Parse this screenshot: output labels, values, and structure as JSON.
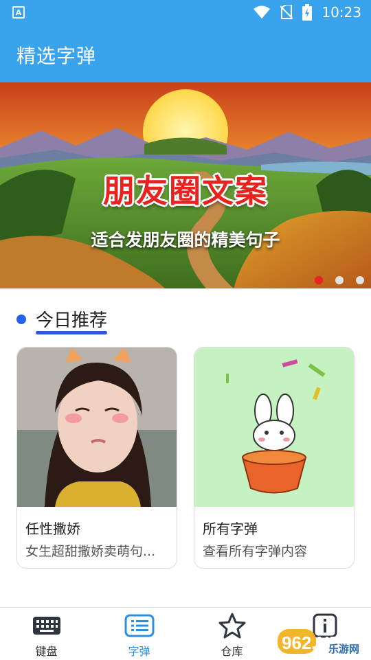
{
  "status_bar": {
    "time": "10:23"
  },
  "app_bar": {
    "title": "精选字弹"
  },
  "banner": {
    "headline": "朋友圈文案",
    "subline": "适合发朋友圈的精美句子",
    "slides": 3,
    "active_slide": 1
  },
  "section": {
    "title": "今日推荐"
  },
  "cards": [
    {
      "name": "任性撒娇",
      "desc": "女生超甜撒娇卖萌句..."
    },
    {
      "name": "所有字弹",
      "desc": "查看所有字弹内容"
    }
  ],
  "tabs": [
    {
      "label": "键盘",
      "icon": "keyboard-icon"
    },
    {
      "label": "字弹",
      "icon": "list-icon",
      "active": true
    },
    {
      "label": "仓库",
      "icon": "star-icon"
    },
    {
      "label": "",
      "icon": "info-icon"
    }
  ],
  "watermark": {
    "line1": "962.NET",
    "line2": "乐游网"
  },
  "colors": {
    "primary": "#3aa3ee",
    "accent_blue": "#2b5bd6",
    "active_dot": "#e8231f"
  }
}
